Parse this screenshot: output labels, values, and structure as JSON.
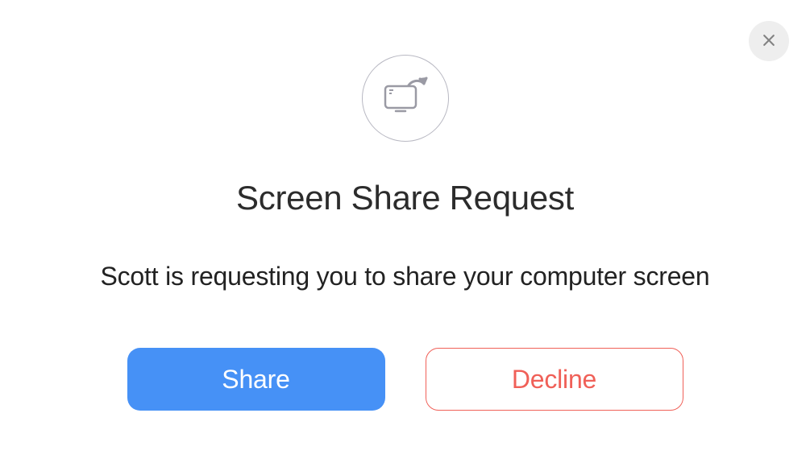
{
  "dialog": {
    "title": "Screen Share Request",
    "message": "Scott is requesting you to share your computer screen",
    "buttons": {
      "share": "Share",
      "decline": "Decline"
    }
  }
}
